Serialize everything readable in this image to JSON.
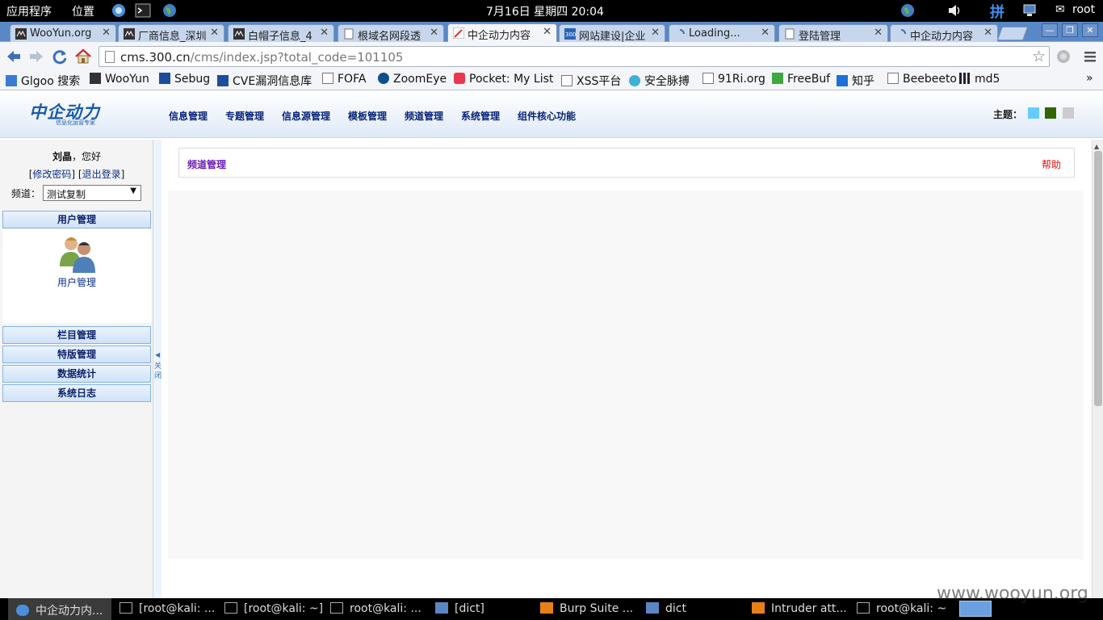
{
  "system_bar": {
    "apps_menu": "应用程序",
    "places_menu": "位置",
    "clock": "7月16日 星期四 20:04",
    "input_method": "拼",
    "user": "root"
  },
  "tabs": [
    {
      "title": "WooYun.org",
      "active": false
    },
    {
      "title": "厂商信息_深圳",
      "active": false
    },
    {
      "title": "白帽子信息_4",
      "active": false
    },
    {
      "title": "根域名网段透",
      "active": false
    },
    {
      "title": "中企动力内容",
      "active": true
    },
    {
      "title": "网站建设|企业",
      "active": false
    },
    {
      "title": "Loading...",
      "active": false
    },
    {
      "title": "登陆管理",
      "active": false
    },
    {
      "title": "中企动力内容",
      "active": false
    }
  ],
  "address_bar": {
    "host": "cms.300.cn",
    "path": "/cms/index.jsp?total_code=101105"
  },
  "bookmarks": [
    "Glgoo 搜索",
    "WooYun",
    "Sebug",
    "CVE漏洞信息库",
    "FOFA",
    "ZoomEye",
    "Pocket: My List",
    "XSS平台",
    "安全脉搏",
    "91Ri.org",
    "FreeBuf",
    "知乎",
    "Beebeeto",
    "md5"
  ],
  "bookmarks_more": "»",
  "header": {
    "logo_text": "中企动力",
    "logo_subtitle": "信息化运营专家",
    "nav": [
      "信息管理",
      "专题管理",
      "信息源管理",
      "模板管理",
      "频道管理",
      "系统管理",
      "组件核心功能"
    ],
    "theme_label": "主题：",
    "theme_colors": [
      "#66ccff",
      "#336600",
      "#cccccc"
    ]
  },
  "sidebar": {
    "user_name": "刘晶",
    "greeting_suffix": "，您好",
    "change_password": "修改密码",
    "logout": "退出登录",
    "channel_label": "频道：",
    "channel_value": "测试复制",
    "sections": [
      "用户管理",
      "栏目管理",
      "特版管理",
      "数据统计",
      "系统日志"
    ],
    "user_mgmt_item": "用户管理",
    "collapse_label": "关闭"
  },
  "main": {
    "breadcrumb": "频道管理",
    "help": "帮助"
  },
  "taskbar": [
    {
      "label": "中企动力内...",
      "active": true
    },
    {
      "label": "[root@kali: ...",
      "active": false
    },
    {
      "label": "[root@kali: ~]",
      "active": false
    },
    {
      "label": "root@kali: ...",
      "active": false
    },
    {
      "label": "[dict]",
      "active": false
    },
    {
      "label": "Burp Suite ...",
      "active": false
    },
    {
      "label": "dict",
      "active": false
    },
    {
      "label": "Intruder att...",
      "active": false
    },
    {
      "label": "root@kali: ~",
      "active": false
    }
  ],
  "watermark": "www.wooyun.org"
}
